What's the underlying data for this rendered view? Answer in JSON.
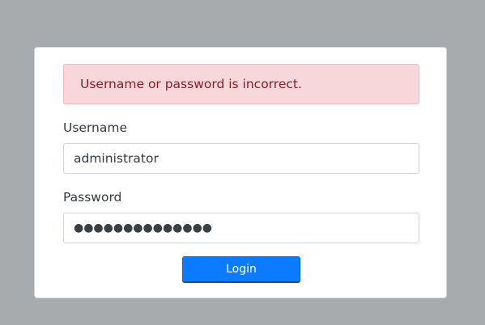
{
  "login": {
    "error_message": "Username or password is incorrect.",
    "username_label": "Username",
    "username_value": "administrator",
    "password_label": "Password",
    "password_masked": "●●●●●●●●●●●●●●",
    "login_button": "Login"
  },
  "colors": {
    "background": "#a8abae",
    "alert_bg": "#f8d7da",
    "alert_text": "#842029",
    "button": "#0d7bff"
  }
}
